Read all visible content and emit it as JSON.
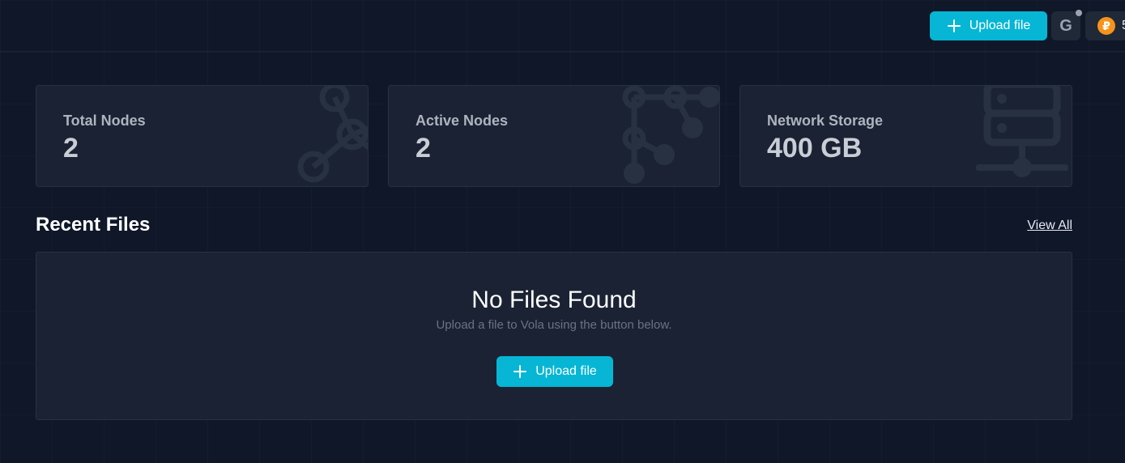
{
  "topbar": {
    "upload_label": "Upload file",
    "g_label": "G",
    "token_symbol": "₽",
    "token_value": "5"
  },
  "stats": [
    {
      "label": "Total Nodes",
      "value": "2",
      "icon": "nodes-network-icon"
    },
    {
      "label": "Active Nodes",
      "value": "2",
      "icon": "nodes-tree-icon"
    },
    {
      "label": "Network Storage",
      "value": "400 GB",
      "icon": "server-storage-icon"
    }
  ],
  "recent_files": {
    "title": "Recent Files",
    "view_all": "View All",
    "empty_title": "No Files Found",
    "empty_subtitle": "Upload a file to Vola using the button below.",
    "upload_label": "Upload file"
  },
  "colors": {
    "background": "#0f1729",
    "card": "#1a2233",
    "accent": "#06b6d4",
    "token": "#f7931a"
  }
}
